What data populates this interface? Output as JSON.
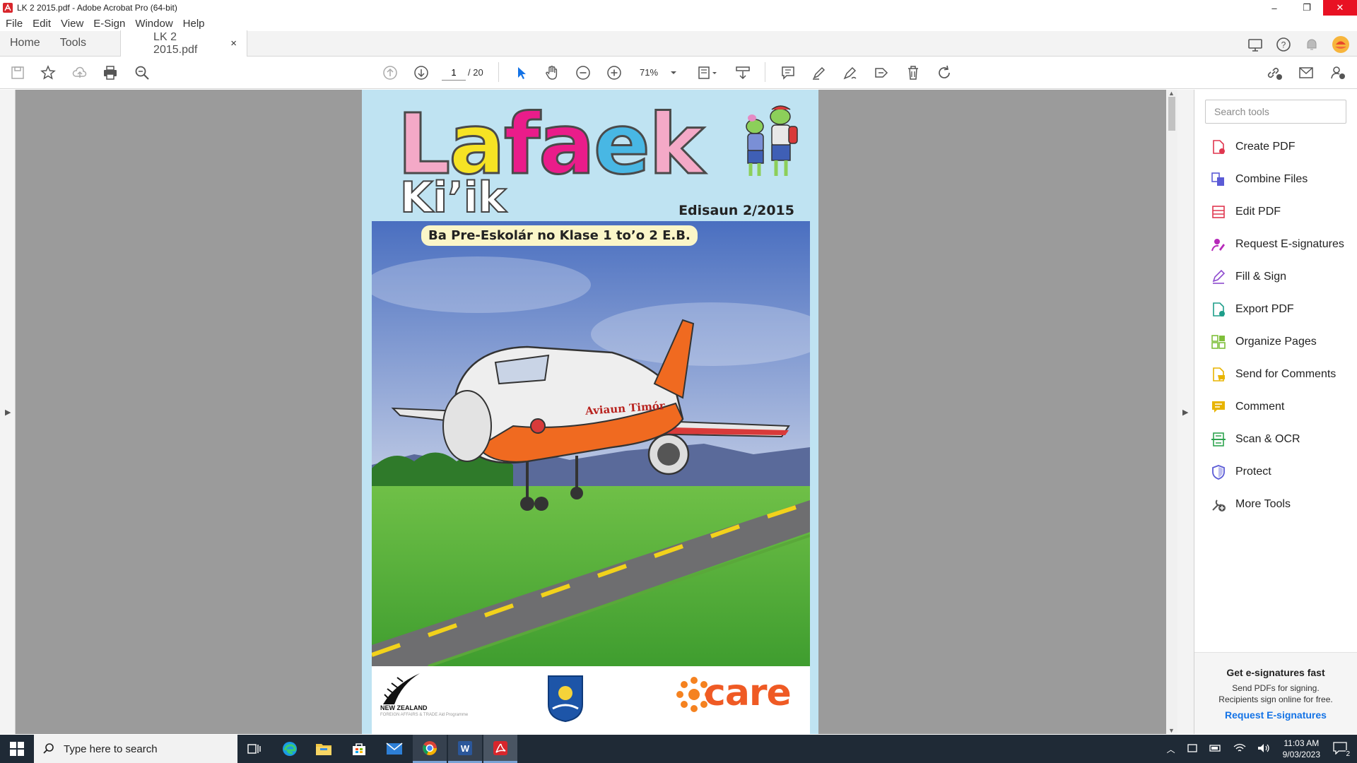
{
  "window": {
    "title": "LK 2 2015.pdf - Adobe Acrobat Pro (64-bit)",
    "minimize": "–",
    "restore": "❐",
    "close": "✕"
  },
  "menu": [
    "File",
    "Edit",
    "View",
    "E-Sign",
    "Window",
    "Help"
  ],
  "tabs": {
    "home": "Home",
    "tools": "Tools",
    "document": "LK 2 2015.pdf",
    "close": "×"
  },
  "toolbar": {
    "page_current": "1",
    "page_total": "/ 20",
    "zoom": "71%"
  },
  "document": {
    "logo_letters": [
      "L",
      "a",
      "f",
      "a",
      "e",
      "k"
    ],
    "logo_colors": [
      "#f4a9c7",
      "#f6e324",
      "#ea1c8a",
      "#ea1c8a",
      "#48b7e4",
      "#f4a9c7"
    ],
    "subtitle": "Ki’ik",
    "edition": "Edisaun 2/2015",
    "banner": "Ba Pre-Eskolár no Klase 1 to’o 2 E.B.",
    "plane_text": "Aviaun Timór",
    "nz_label": "NEW ZEALAND",
    "nz_sub": "FOREIGN AFFAIRS & TRADE Aid Programme",
    "care_label": "care"
  },
  "tools_pane": {
    "search_placeholder": "Search tools",
    "items": [
      {
        "label": "Create PDF",
        "icon": "create-pdf-icon",
        "color": "#e0364f"
      },
      {
        "label": "Combine Files",
        "icon": "combine-files-icon",
        "color": "#5b5bd6"
      },
      {
        "label": "Edit PDF",
        "icon": "edit-pdf-icon",
        "color": "#e0364f"
      },
      {
        "label": "Request E-signatures",
        "icon": "request-esignatures-icon",
        "color": "#b62ab9"
      },
      {
        "label": "Fill & Sign",
        "icon": "fill-sign-icon",
        "color": "#8e4bcf"
      },
      {
        "label": "Export PDF",
        "icon": "export-pdf-icon",
        "color": "#1e9e8a"
      },
      {
        "label": "Organize Pages",
        "icon": "organize-pages-icon",
        "color": "#7fbf3a"
      },
      {
        "label": "Send for Comments",
        "icon": "send-for-comments-icon",
        "color": "#e8b400"
      },
      {
        "label": "Comment",
        "icon": "comment-icon",
        "color": "#e8b400"
      },
      {
        "label": "Scan & OCR",
        "icon": "scan-ocr-icon",
        "color": "#2ea44f"
      },
      {
        "label": "Protect",
        "icon": "protect-icon",
        "color": "#5b5bd6"
      },
      {
        "label": "More Tools",
        "icon": "more-tools-icon",
        "color": "#555555"
      }
    ],
    "promo_title": "Get e-signatures fast",
    "promo_line1": "Send PDFs for signing.",
    "promo_line2": "Recipients sign online for free.",
    "promo_link": "Request E-signatures"
  },
  "taskbar": {
    "search_placeholder": "Type here to search",
    "time": "11:03 AM",
    "date": "9/03/2023",
    "notifications": "2"
  },
  "colors": {
    "accent": "#1473e6",
    "close_red": "#e81123"
  }
}
